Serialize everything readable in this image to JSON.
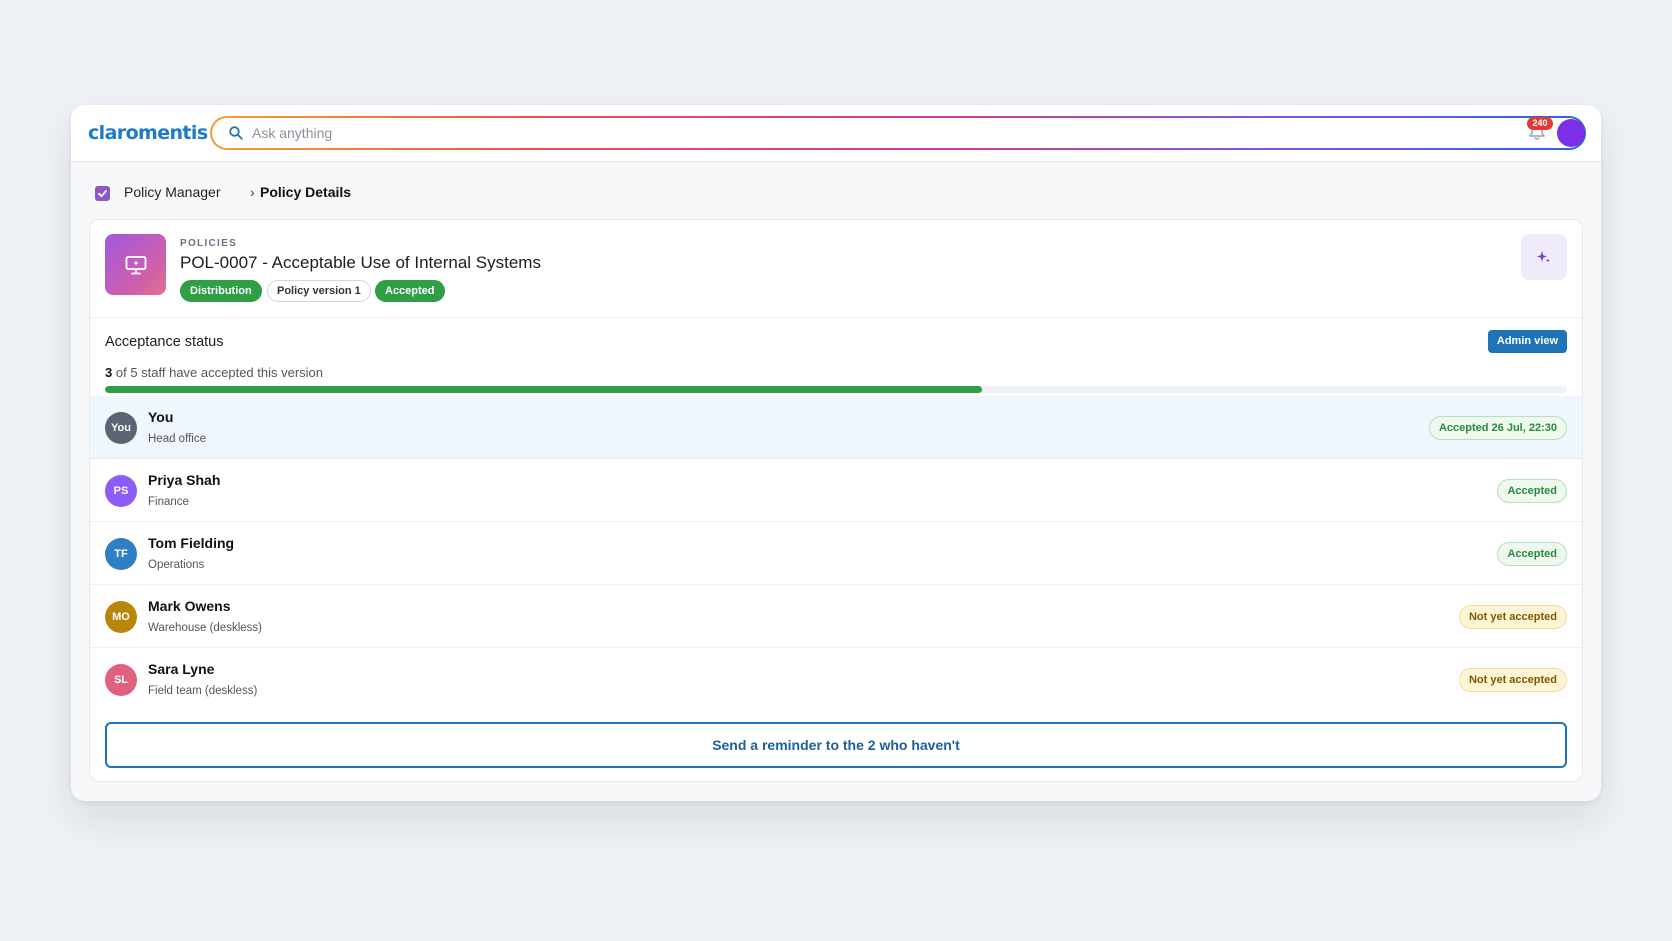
{
  "app": {
    "logo": "claromentis",
    "search_placeholder": "Ask anything",
    "notifications_count": "240"
  },
  "breadcrumb": {
    "parent": "Policy Manager",
    "separator": "›",
    "current": "Policy Details"
  },
  "policy": {
    "eyebrow": "POLICIES",
    "title": "POL-0007 - Acceptable Use of Internal Systems",
    "tags": [
      "Distribution",
      "Policy version 1",
      "Accepted"
    ]
  },
  "acceptance": {
    "title": "Acceptance status",
    "admin_button": "Admin view",
    "accepted_count": "3",
    "summary_suffix": "of 5 staff have accepted this version",
    "progress_fraction": 0.6,
    "staff": [
      {
        "initials": "You",
        "name": "You",
        "dept": "Head office",
        "status": "Accepted 26 Jul, 22:30",
        "state": "ok",
        "color": "#5a6472",
        "self": true
      },
      {
        "initials": "PS",
        "name": "Priya Shah",
        "dept": "Finance",
        "status": "Accepted",
        "state": "ok",
        "color": "#8b5cf6",
        "self": false
      },
      {
        "initials": "TF",
        "name": "Tom Fielding",
        "dept": "Operations",
        "status": "Accepted",
        "state": "ok",
        "color": "#2f7fc6",
        "self": false
      },
      {
        "initials": "MO",
        "name": "Mark Owens",
        "dept": "Warehouse (deskless)",
        "status": "Not yet accepted",
        "state": "pending",
        "color": "#b8860b",
        "self": false
      },
      {
        "initials": "SL",
        "name": "Sara Lyne",
        "dept": "Field team (deskless)",
        "status": "Not yet accepted",
        "state": "pending",
        "color": "#e0607e",
        "self": false
      }
    ],
    "reminder_button": "Send a reminder to the 2 who haven't"
  },
  "colors": {
    "accent_blue": "#1f73b7",
    "success_green": "#2f9e44",
    "avatar_purple": "#7b2fe6"
  }
}
